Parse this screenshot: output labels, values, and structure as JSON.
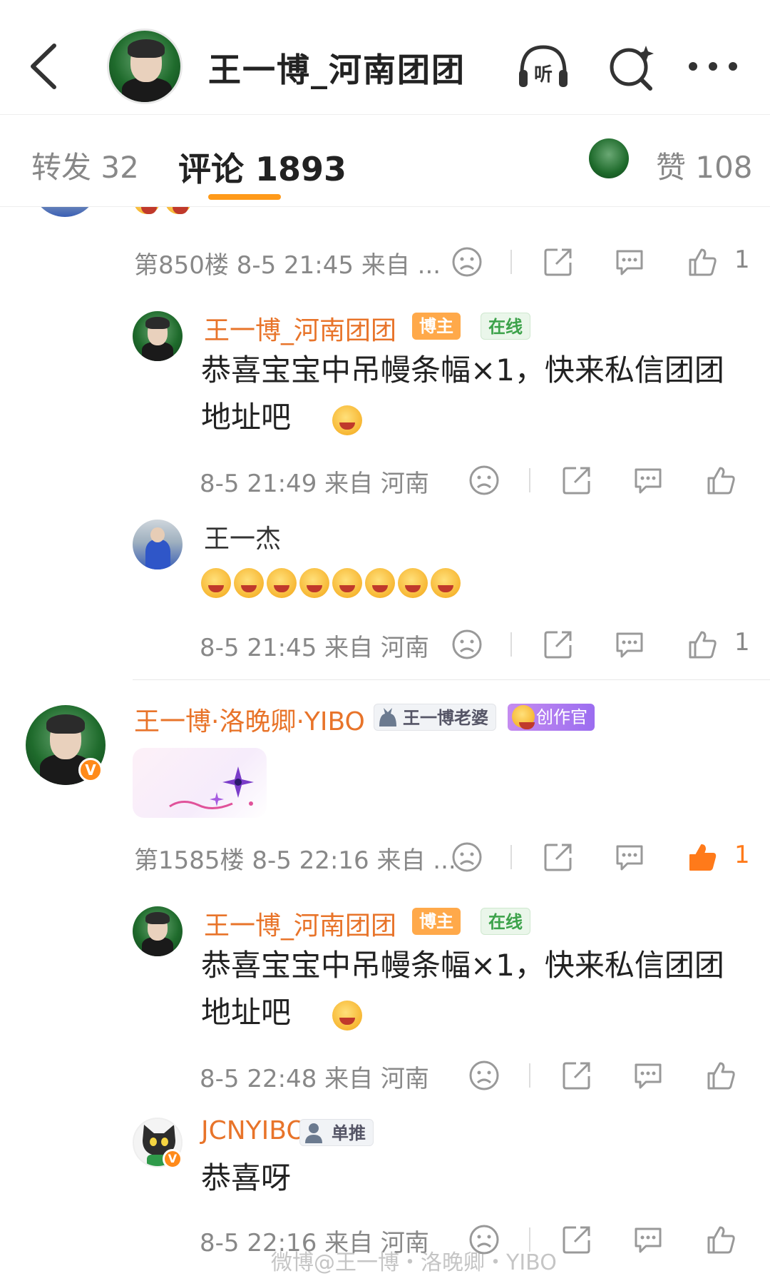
{
  "header": {
    "title": "王一博_河南团团",
    "listen_label": "听"
  },
  "tabs": {
    "repost": "转发 32",
    "comment": "评论 1893",
    "like": "赞 108"
  },
  "comments": [
    {
      "floor_meta": "第850楼 8-5 21:45 来自 ...",
      "like_count": "1",
      "replies": [
        {
          "name": "王一博_河南团团",
          "badges": [
            "博主",
            "在线"
          ],
          "text": "恭喜宝宝中吊幔条幅×1，快来私信团团地址吧",
          "meta": "8-5 21:49 来自 河南"
        },
        {
          "name": "王一杰",
          "text": "",
          "meta": "8-5 21:45 来自 河南",
          "like_count": "1"
        }
      ]
    },
    {
      "name": "王一博·洛晚卿·YIBO",
      "badges": [
        "王一博老婆",
        "创作官"
      ],
      "floor_meta": "第1585楼 8-5 22:16 来自 ...",
      "like_count": "1",
      "replies": [
        {
          "name": "王一博_河南团团",
          "badges": [
            "博主",
            "在线"
          ],
          "text": "恭喜宝宝中吊幔条幅×1，快来私信团团地址吧",
          "meta": "8-5 22:48 来自 河南"
        },
        {
          "name": "JCNYIBO",
          "badges": [
            "单推"
          ],
          "text": "恭喜呀",
          "meta": "8-5 22:16 来自 河南"
        }
      ]
    }
  ],
  "watermark": "微博@王一博・洛晚卿・YIBO",
  "colors": {
    "accent": "#ff9a1a",
    "name": "#e8742a",
    "liked": "#ff7a1a"
  }
}
